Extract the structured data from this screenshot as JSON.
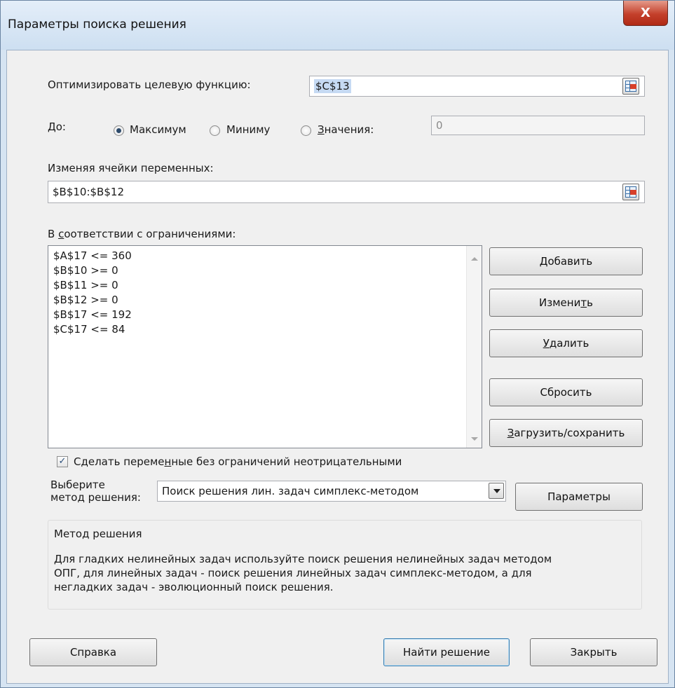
{
  "window": {
    "title": "Параметры поиска решения",
    "close_label": "X"
  },
  "objective": {
    "label_pre": "Оптимизировать целев",
    "label_accel": "у",
    "label_post": "ю функцию:",
    "value": "$C$13"
  },
  "to": {
    "label": "До:",
    "options": [
      {
        "label": "Максимум",
        "selected": true
      },
      {
        "label": "Миниму",
        "selected": false
      },
      {
        "label_accel": "З",
        "label_rest": "начения:",
        "selected": false
      }
    ],
    "value_of": "0"
  },
  "variables": {
    "label": "Изменяя ячейки переменных:",
    "value": "$B$10:$B$12"
  },
  "constraints": {
    "label_pre": "В ",
    "label_accel": "с",
    "label_post": "оответствии с ограничениями:",
    "items": [
      "$A$17 <= 360",
      "$B$10 >= 0",
      "$B$11 >= 0",
      "$B$12 >= 0",
      "$B$17 <= 192",
      "$C$17 <= 84"
    ]
  },
  "buttons": {
    "add": {
      "accel": "Д",
      "rest": "обавить"
    },
    "change": {
      "pre": "Измени",
      "accel": "т",
      "post": "ь"
    },
    "delete": {
      "accel": "У",
      "rest": "далить"
    },
    "reset": "Сбросить",
    "load_save": {
      "accel": "З",
      "rest": "агрузить/сохранить"
    },
    "options": "Параметры",
    "help": "Справка",
    "solve": "Найти решение",
    "close": "Закрыть"
  },
  "nonneg": {
    "checked": true,
    "label_pre": "Сделать переме",
    "label_accel": "н",
    "label_post": "ные без ограничений неотрицательными"
  },
  "method": {
    "label_line1": "Выберите",
    "label_line2": "метод решения:",
    "selected": "Поиск решения лин. задач симплекс-методом"
  },
  "method_group": {
    "title": "Метод решения",
    "line1": "Для гладких нелинейных задач используйте поиск решения нелинейных задач методом",
    "line2": "ОПГ, для линейных задач - поиск решения линейных задач симплекс-методом, а для",
    "line3": "негладких задач - эволюционный поиск решения."
  }
}
